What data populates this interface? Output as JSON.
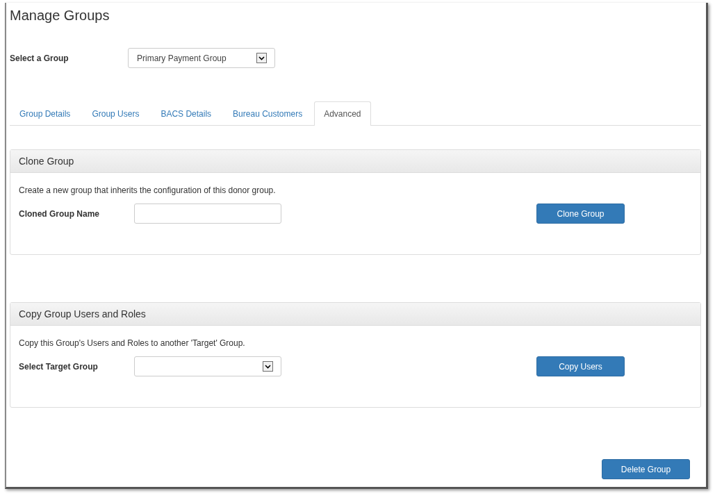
{
  "page_title": "Manage Groups",
  "group_select": {
    "label": "Select a Group",
    "value": "Primary Payment Group"
  },
  "tabs": [
    {
      "label": "Group Details",
      "selected": false
    },
    {
      "label": "Group Users",
      "selected": false
    },
    {
      "label": "BACS Details",
      "selected": false
    },
    {
      "label": "Bureau Customers",
      "selected": false
    },
    {
      "label": "Advanced",
      "selected": true
    }
  ],
  "panels": [
    {
      "title": "Clone Group",
      "description": "Create a new group that inherits the configuration of this donor group.",
      "field_label": "Cloned Group Name",
      "kind": "text",
      "button": "Clone Group"
    },
    {
      "title": "Copy Group Users and Roles",
      "description": "Copy this Group's Users and Roles to another 'Target' Group.",
      "field_label": "Select Target Group",
      "kind": "select",
      "button": "Copy Users"
    }
  ],
  "delete_button": "Delete Group"
}
